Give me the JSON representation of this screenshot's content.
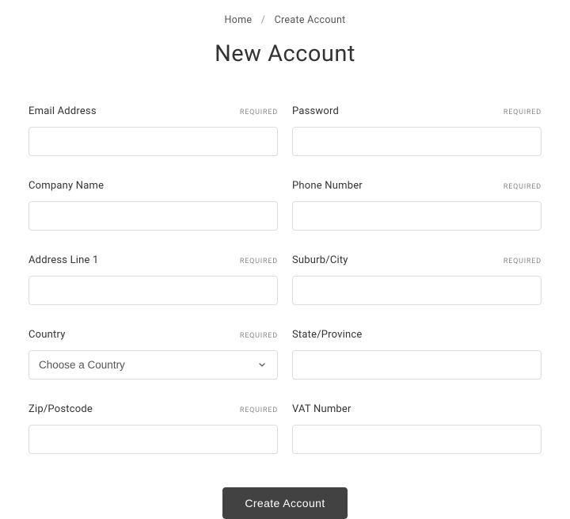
{
  "breadcrumb": {
    "home": "Home",
    "sep": "/",
    "current": "Create Account"
  },
  "title": "New Account",
  "labels": {
    "required": "REQUIRED"
  },
  "fields": {
    "email": {
      "label": "Email Address",
      "required": true
    },
    "password": {
      "label": "Password",
      "required": true
    },
    "company": {
      "label": "Company Name",
      "required": false
    },
    "phone": {
      "label": "Phone Number",
      "required": true
    },
    "address1": {
      "label": "Address Line 1",
      "required": true
    },
    "city": {
      "label": "Suburb/City",
      "required": true
    },
    "country": {
      "label": "Country",
      "required": true,
      "placeholder": "Choose a Country"
    },
    "state": {
      "label": "State/Province",
      "required": false
    },
    "zip": {
      "label": "Zip/Postcode",
      "required": true
    },
    "vat": {
      "label": "VAT Number",
      "required": false
    }
  },
  "submit": {
    "label": "Create Account"
  }
}
